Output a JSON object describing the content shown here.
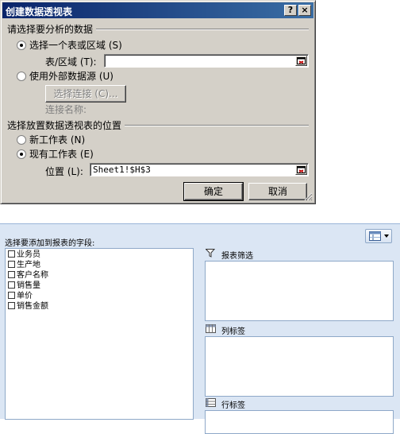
{
  "dialog": {
    "title": "创建数据透视表",
    "help_btn": "?",
    "close_btn": "×",
    "section1": "请选择要分析的数据",
    "opt_table": "选择一个表或区域 (S)",
    "range_label": "表/区域 (T):",
    "range_value": "",
    "opt_external": "使用外部数据源 (U)",
    "choose_connection": "选择连接 (C)...",
    "connection_name": "连接名称:",
    "section2": "选择放置数据透视表的位置",
    "opt_new_sheet": "新工作表 (N)",
    "opt_existing_sheet": "现有工作表 (E)",
    "location_label": "位置 (L):",
    "location_value": "Sheet1!$H$3",
    "ok": "确定",
    "cancel": "取消"
  },
  "field_list": {
    "caption": "选择要添加到报表的字段:",
    "fields": [
      "业务员",
      "生产地",
      "客户名称",
      "销售量",
      "单价",
      "销售金额"
    ],
    "areas": {
      "report_filter": "报表筛选",
      "column_labels": "列标签",
      "row_labels": "行标签"
    }
  },
  "colors": {
    "title_start": "#0a246a",
    "title_end": "#3a6ea5",
    "dialog_bg": "#d4d0c8",
    "pane_bg": "#dbe6f4"
  }
}
